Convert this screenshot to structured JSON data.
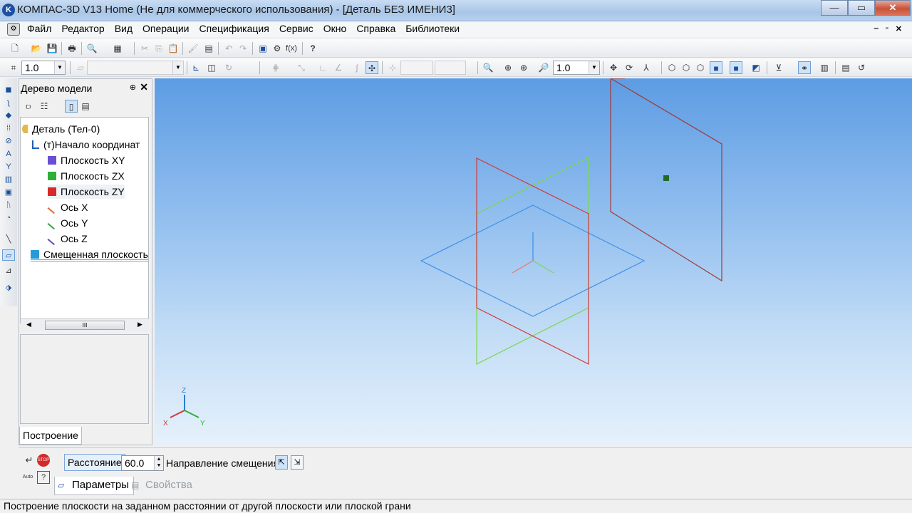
{
  "window": {
    "title": "КОМПАС-3D V13 Home (Не для коммерческого использования) - [Деталь БЕЗ ИМЕНИ3]",
    "app_icon": "K",
    "minimize_glyph": "—",
    "maximize_glyph": "▭",
    "close_glyph": "✕"
  },
  "menu": {
    "items": [
      "Файл",
      "Редактор",
      "Вид",
      "Операции",
      "Спецификация",
      "Сервис",
      "Окно",
      "Справка",
      "Библиотеки"
    ],
    "mdi_minimize": "‒",
    "mdi_restore": "▫",
    "mdi_close": "✕"
  },
  "toolbar": {
    "step_value": "1.0",
    "zoom_value": "1.0",
    "style_value": ""
  },
  "tree": {
    "title": "Дерево модели",
    "pin_glyph": "⊕",
    "close_glyph": "✕",
    "nodes": [
      {
        "label": "Деталь (Тел-0)",
        "icon": "part-icon",
        "color": "#c79a1a"
      },
      {
        "label": "(т)Начало координат",
        "icon": "origin-icon",
        "color": "#1d5fb3"
      },
      {
        "label": "Плоскость XY",
        "icon": "plane-icon",
        "color": "#6a4fd6"
      },
      {
        "label": "Плоскость ZX",
        "icon": "plane-icon",
        "color": "#2fae3a"
      },
      {
        "label": "Плоскость ZY",
        "icon": "plane-icon",
        "color": "#d62a2a"
      },
      {
        "label": "Ось X",
        "icon": "axis-icon",
        "color": "#e06b3a"
      },
      {
        "label": "Ось Y",
        "icon": "axis-icon",
        "color": "#3aa64a"
      },
      {
        "label": "Ось Z",
        "icon": "axis-icon",
        "color": "#6a4fb8"
      },
      {
        "label": "Смещенная плоскость",
        "icon": "offset-plane-icon",
        "color": "#2a9ad6"
      }
    ],
    "scroll_thumb": "III",
    "tab_label": "Построение"
  },
  "viewport": {
    "axis_labels": {
      "x": "X",
      "y": "Y",
      "z": "Z"
    }
  },
  "properties": {
    "distance_label": "Расстояние",
    "distance_value": "60.0",
    "direction_label": "Направление смещения",
    "tabs": [
      "Параметры",
      "Свойства"
    ],
    "stop_label": "STOP",
    "auto_label": "Auto"
  },
  "status": {
    "text": "Построение плоскости на заданном расстоянии от другой плоскости или плоской грани"
  },
  "colors": {
    "plane_xy": "#3a8fe8",
    "plane_zx": "#7ad84a",
    "plane_zy": "#d33a3a",
    "offset_plane": "#a03a3a"
  }
}
